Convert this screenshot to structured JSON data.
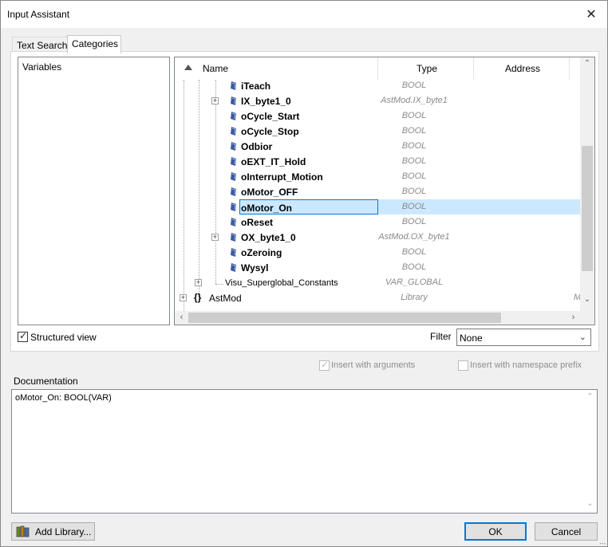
{
  "window": {
    "title": "Input Assistant"
  },
  "tabs": [
    {
      "label": "Text Search"
    },
    {
      "label": "Categories"
    }
  ],
  "categories": [
    "Variables"
  ],
  "tree": {
    "columns": {
      "name": "Name",
      "type": "Type",
      "address": "Address"
    },
    "rows": [
      {
        "name": "iTeach",
        "type": "BOOL"
      },
      {
        "name": "IX_byte1_0",
        "type": "AstMod.IX_byte1"
      },
      {
        "name": "oCycle_Start",
        "type": "BOOL"
      },
      {
        "name": "oCycle_Stop",
        "type": "BOOL"
      },
      {
        "name": "Odbior",
        "type": "BOOL"
      },
      {
        "name": "oEXT_IT_Hold",
        "type": "BOOL"
      },
      {
        "name": "oInterrupt_Motion",
        "type": "BOOL"
      },
      {
        "name": "oMotor_OFF",
        "type": "BOOL"
      },
      {
        "name": "oMotor_On",
        "type": "BOOL"
      },
      {
        "name": "oReset",
        "type": "BOOL"
      },
      {
        "name": "OX_byte1_0",
        "type": "AstMod.OX_byte1"
      },
      {
        "name": "oZeroing",
        "type": "BOOL"
      },
      {
        "name": "Wysyl",
        "type": "BOOL"
      },
      {
        "name": "Visu_Superglobal_Constants",
        "type": "VAR_GLOBAL"
      },
      {
        "name": "AstMod",
        "type": "Library",
        "address_truncated": "M"
      }
    ],
    "selected": "oMotor_On"
  },
  "structured_view": {
    "label": "Structured view",
    "checked": true
  },
  "filter": {
    "label": "Filter",
    "value": "None"
  },
  "insert_with_arguments": {
    "label": "Insert with arguments",
    "checked": true
  },
  "insert_with_namespace": {
    "label": "Insert with namespace prefix",
    "checked": false
  },
  "documentation": {
    "label": "Documentation",
    "text": "oMotor_On: BOOL(VAR)"
  },
  "buttons": {
    "add_library": "Add Library...",
    "ok": "OK",
    "cancel": "Cancel"
  }
}
